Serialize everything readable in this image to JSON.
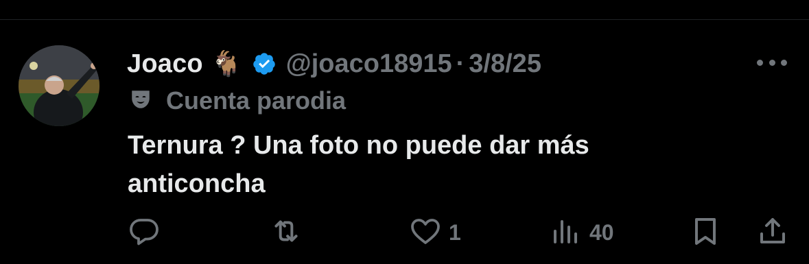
{
  "tweet": {
    "author": {
      "display_name": "Joaco",
      "emoji": "🐐",
      "handle": "@joaco18915",
      "separator": "·",
      "date": "3/8/25",
      "verified": true,
      "parody_label": "Cuenta parodia"
    },
    "text_line1": "Ternura ? Una foto no puede dar más",
    "text_line2": "anticoncha",
    "actions": {
      "reply_count": "",
      "retweet_count": "",
      "like_count": "1",
      "views_count": "40"
    }
  },
  "colors": {
    "background": "#000000",
    "text_primary": "#e7e9ea",
    "text_secondary": "#71767b",
    "verified_blue": "#1d9bf0"
  },
  "icons": [
    "more-icon",
    "verified-badge-icon",
    "parody-mask-icon",
    "reply-icon",
    "retweet-icon",
    "like-icon",
    "views-icon",
    "bookmark-icon",
    "share-icon"
  ]
}
